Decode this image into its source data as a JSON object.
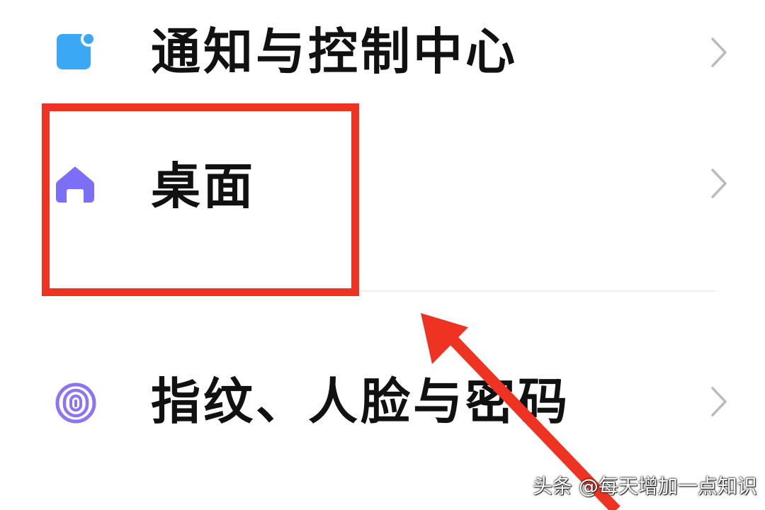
{
  "settings": {
    "items": [
      {
        "label": "通知与控制中心",
        "icon": "notification-center-icon"
      },
      {
        "label": "桌面",
        "icon": "home-icon"
      },
      {
        "label": "指纹、人脸与密码",
        "icon": "fingerprint-icon"
      }
    ]
  },
  "colors": {
    "notify_icon": "#3aa8f5",
    "home_icon": "#7b6ff5",
    "fingerprint_icon": "#8a76f2",
    "highlight": "#ee3322",
    "chevron": "#bbbbbb"
  },
  "watermark": {
    "text": "头条 @每天增加一点知识"
  }
}
